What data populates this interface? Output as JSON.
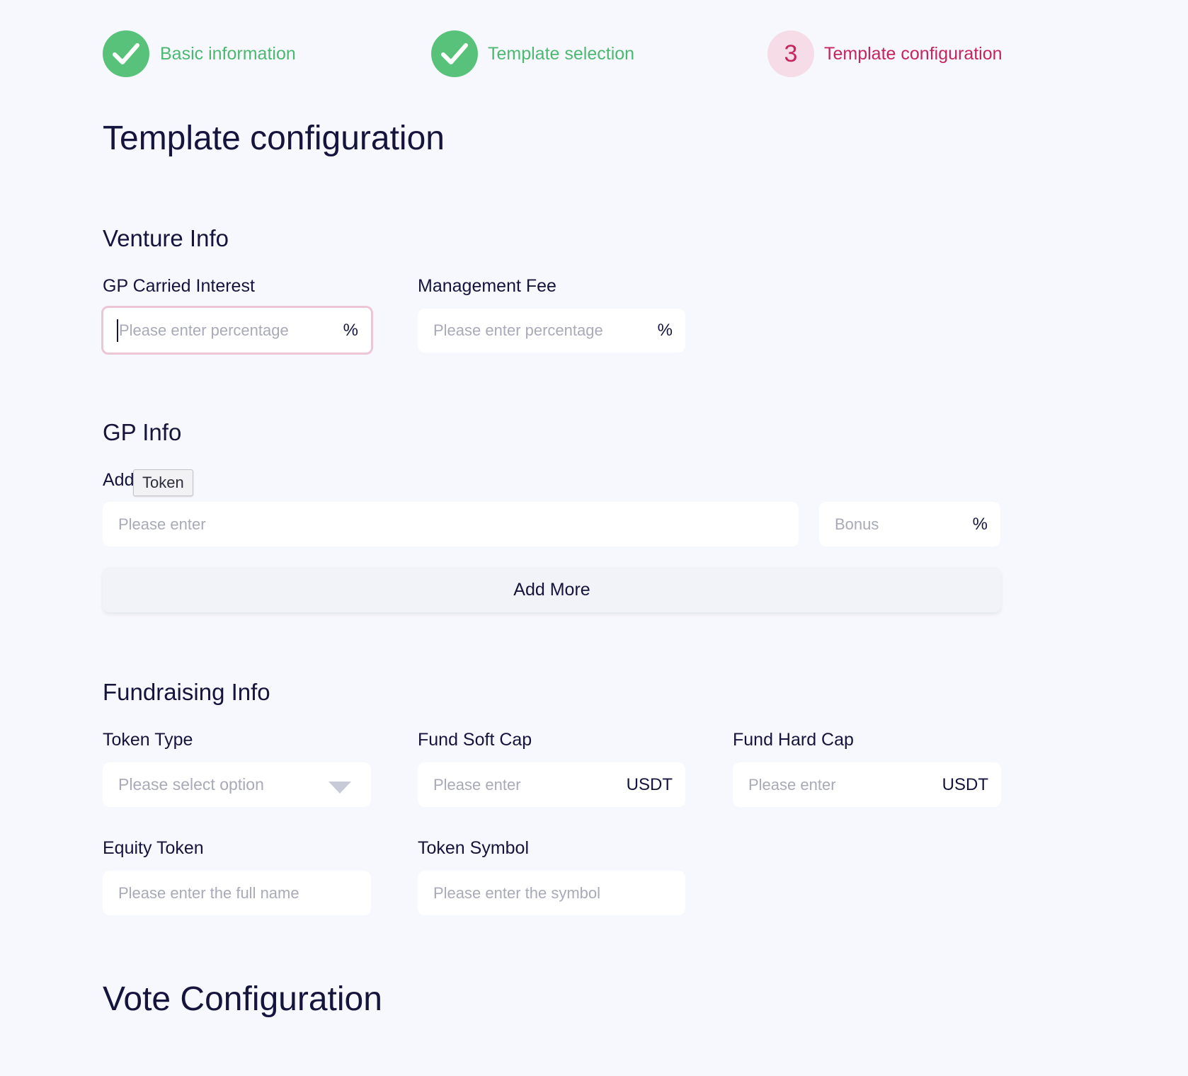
{
  "stepper": {
    "steps": [
      {
        "label": "Basic information",
        "status": "done",
        "icon": "check-icon"
      },
      {
        "label": "Template selection",
        "status": "done",
        "icon": "check-icon"
      },
      {
        "number": "3",
        "label": "Template configuration",
        "status": "active"
      }
    ],
    "colors": {
      "done": "#58c27a",
      "active": "#c6245c",
      "active_bg": "#f5dce6"
    }
  },
  "page_title": "Template configuration",
  "venture_info": {
    "title": "Venture Info",
    "gp_carried_interest": {
      "label": "GP Carried Interest",
      "placeholder": "Please enter percentage",
      "suffix": "%"
    },
    "management_fee": {
      "label": "Management Fee",
      "placeholder": "Please enter percentage",
      "suffix": "%"
    }
  },
  "gp_info": {
    "title": "GP Info",
    "add_label": "Add",
    "tooltip": "Token",
    "address": {
      "placeholder": "Please enter"
    },
    "bonus": {
      "placeholder": "Bonus",
      "suffix": "%"
    },
    "add_more": "Add More"
  },
  "fundraising_info": {
    "title": "Fundraising Info",
    "token_type": {
      "label": "Token Type",
      "placeholder": "Please select option",
      "icon": "chevron-down-icon"
    },
    "fund_soft_cap": {
      "label": "Fund Soft Cap",
      "placeholder": "Please enter",
      "suffix": "USDT"
    },
    "fund_hard_cap": {
      "label": "Fund Hard Cap",
      "placeholder": "Please enter",
      "suffix": "USDT"
    },
    "equity_token": {
      "label": "Equity Token",
      "placeholder": "Please enter the full name"
    },
    "token_symbol": {
      "label": "Token Symbol",
      "placeholder": "Please enter the symbol"
    }
  },
  "vote_configuration": {
    "title": "Vote Configuration"
  }
}
